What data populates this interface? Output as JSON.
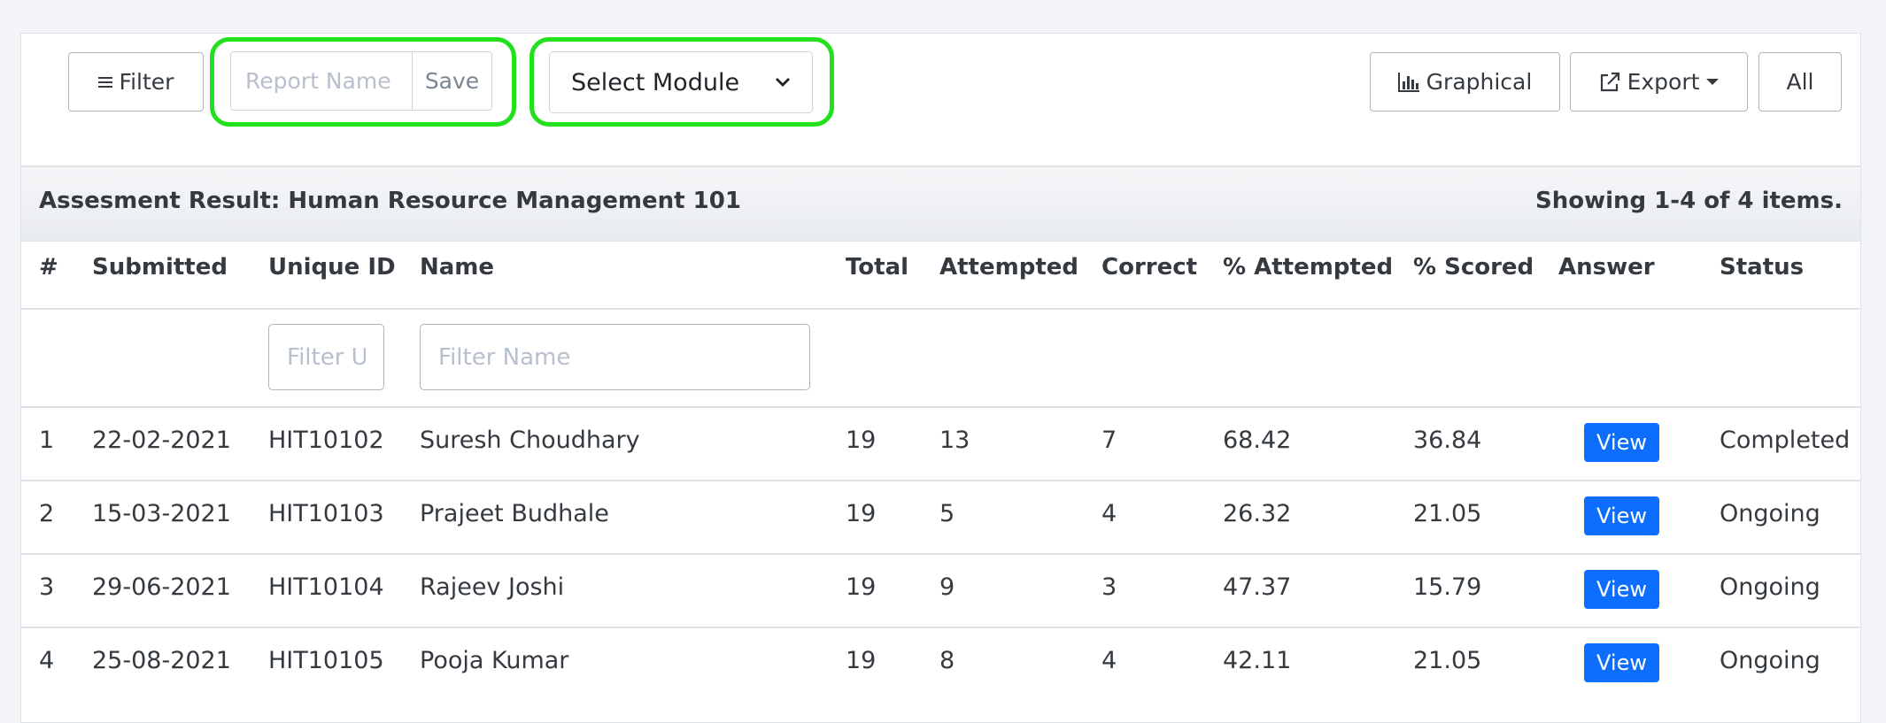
{
  "toolbar": {
    "filter_label": "Filter",
    "report_name_placeholder": "Report Name",
    "save_label": "Save",
    "module_select_value": "Select Module",
    "graphical_label": "Graphical",
    "export_label": "Export",
    "all_label": "All"
  },
  "summary": {
    "title": "Assesment Result: Human Resource Management 101",
    "showing": "Showing 1-4 of 4 items."
  },
  "table": {
    "headers": [
      "#",
      "Submitted",
      "Unique ID",
      "Name",
      "Total",
      "Attempted",
      "Correct",
      "% Attempted",
      "% Scored",
      "Answer",
      "Status"
    ],
    "filter_unique_placeholder": "Filter Unique ID",
    "filter_name_placeholder": "Filter Name",
    "rows": [
      {
        "num": "1",
        "submitted": "22-02-2021",
        "uid": "HIT10102",
        "name": "Suresh Choudhary",
        "total": "19",
        "attempted": "13",
        "correct": "7",
        "pct_attempted": "68.42",
        "pct_scored": "36.84",
        "answer": "View",
        "status": "Completed"
      },
      {
        "num": "2",
        "submitted": "15-03-2021",
        "uid": "HIT10103",
        "name": "Prajeet Budhale",
        "total": "19",
        "attempted": "5",
        "correct": "4",
        "pct_attempted": "26.32",
        "pct_scored": "21.05",
        "answer": "View",
        "status": "Ongoing"
      },
      {
        "num": "3",
        "submitted": "29-06-2021",
        "uid": "HIT10104",
        "name": "Rajeev Joshi",
        "total": "19",
        "attempted": "9",
        "correct": "3",
        "pct_attempted": "47.37",
        "pct_scored": "15.79",
        "answer": "View",
        "status": "Ongoing"
      },
      {
        "num": "4",
        "submitted": "25-08-2021",
        "uid": "HIT10105",
        "name": "Pooja Kumar",
        "total": "19",
        "attempted": "8",
        "correct": "4",
        "pct_attempted": "42.11",
        "pct_scored": "21.05",
        "answer": "View",
        "status": "Ongoing"
      }
    ]
  },
  "colors": {
    "highlight": "#22e01c",
    "primary": "#0d6efd"
  },
  "icons": {
    "filter": "menu-lines-icon",
    "graphical": "bar-chart-icon",
    "export": "external-link-icon",
    "select": "chevron-down-icon",
    "export_caret": "caret-down-icon"
  }
}
